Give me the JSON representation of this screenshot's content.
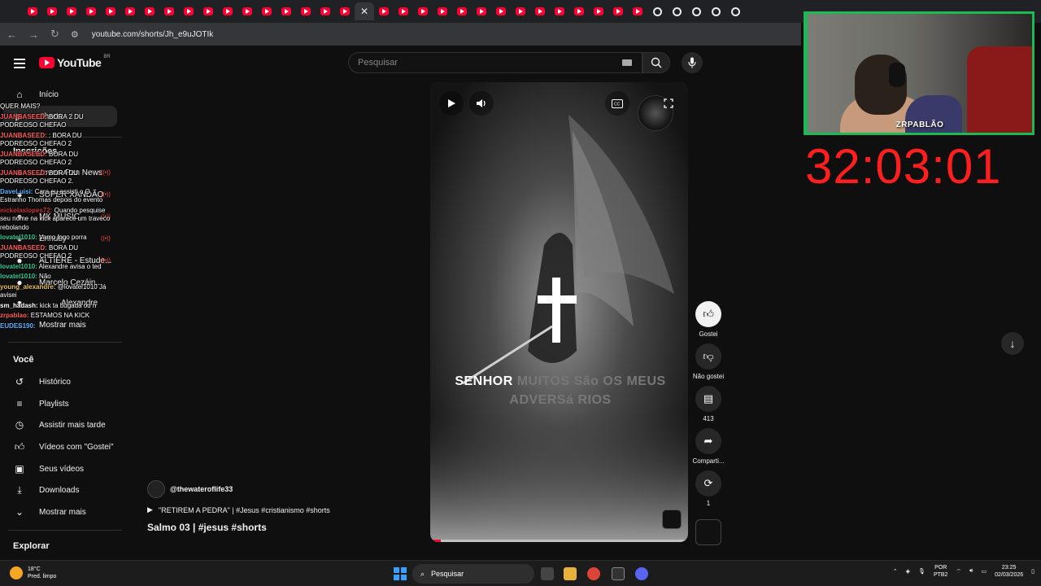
{
  "browser": {
    "url": "youtube.com/shorts/Jh_e9uJOTIk"
  },
  "youtube": {
    "logo_text": "YouTube",
    "country_code": "BR",
    "search_placeholder": "Pesquisar"
  },
  "sidebar": {
    "items_top": [
      {
        "label": "Início",
        "icon": "home-icon"
      },
      {
        "label": "Shorts",
        "icon": "shorts-icon"
      }
    ],
    "subscriptions_heading": "Inscrições",
    "subscriptions": [
      {
        "label": "Jovem Pan News",
        "live": true
      },
      {
        "label": "SUPER XANDÃO",
        "live": true
      },
      {
        "label": "MK MUSIC",
        "live": true
      },
      {
        "label": "Ennuby",
        "live": true
      },
      {
        "label": "ALTIERE - Estude...",
        "live": true
      },
      {
        "label": "Marcelo Cezáin...",
        "live": false
      },
      {
        "label": "Alexandre",
        "live": false
      }
    ],
    "subscriptions_more": "Mostrar mais",
    "you_heading": "Você",
    "you_items": [
      {
        "label": "Histórico",
        "icon": "history-icon"
      },
      {
        "label": "Playlists",
        "icon": "playlist-icon"
      },
      {
        "label": "Assistir mais tarde",
        "icon": "clock-icon"
      },
      {
        "label": "Vídeos com \"Gostei\"",
        "icon": "thumbs-up-icon"
      },
      {
        "label": "Seus vídeos",
        "icon": "video-icon"
      },
      {
        "label": "Downloads",
        "icon": "download-icon"
      },
      {
        "label": "Mostrar mais",
        "icon": "chevron-down-icon"
      }
    ],
    "explore_heading": "Explorar"
  },
  "chat": [
    {
      "user": "",
      "text": "QUER MAIS?"
    },
    {
      "user": "JUANBASEED:",
      "text": "BORA 2 DU PODREOSO CHEFAO"
    },
    {
      "user": "JUANBASEED:",
      "text": ": BORA DU PODREOSO CHEFAO 2"
    },
    {
      "user": "JUANBASEED:",
      "text": "BORA DU PODREOSO CHEFAO 2"
    },
    {
      "user": "JUANBASEED:",
      "text": "BORA DU PODREOSO CHEFAO 2."
    },
    {
      "user": "DaveLuisi:",
      "text": "Cara eu assisti o O Estranho Thomas depois do evento"
    },
    {
      "user": "nickolaslopes72:",
      "text": "Quando pesquise seu nome na kick aparece um traveco rebolando"
    },
    {
      "user": "lovatel1010:",
      "text": "Vamo logo porra"
    },
    {
      "user": "JUANBASEED:",
      "text": "BORA DU PODREOSO CHEFAO 2"
    },
    {
      "user": "lovatel1010:",
      "text": "Alexandre avisa o ted"
    },
    {
      "user": "lovatel1010:",
      "text": "Não"
    },
    {
      "user": "young_alexandre:",
      "text": "@lovatel1010 Já avisei"
    },
    {
      "user": "sm_hadash:",
      "text": "kick ta bugada ou n"
    },
    {
      "user": "zrpablao:",
      "text": "ESTAMOS NA KICK"
    },
    {
      "user": "EUDES190:",
      "text": ""
    }
  ],
  "player": {
    "caption_highlight": "SENHOR",
    "caption_rest": "MUITOS São OS MEUS ADVERSá RIOS",
    "progress_fraction": 0.04
  },
  "actions": {
    "like_label": "Gostei",
    "dislike_label": "Não gostei",
    "comments_count": "413",
    "share_label": "Comparti...",
    "remix_count": "1"
  },
  "video": {
    "channel": "@thewateroflife33",
    "related": "\"RETIREM A PEDRA\" | #Jesus #cristianismo #shorts",
    "title": "Salmo 03 | #jesus #shorts"
  },
  "stream": {
    "streamer_name": "ZRPABLÃO",
    "timer": "32:03:01"
  },
  "taskbar": {
    "temperature": "18°C",
    "weather": "Pred. limpo",
    "search_label": "Pesquisar",
    "lang_1": "POR",
    "lang_2": "PTB2",
    "time": "23:25",
    "date": "02/03/2026"
  },
  "colors": {
    "youtube_red": "#ff0033",
    "timer_red": "#ff1e1e",
    "webcam_border": "#1db954",
    "background": "#0f0f0f"
  }
}
